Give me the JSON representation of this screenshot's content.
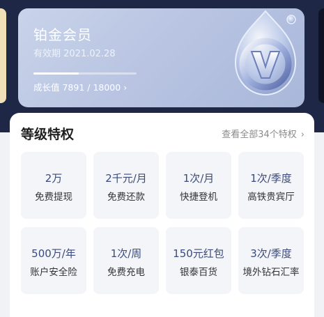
{
  "member": {
    "tier_name": "铂金会员",
    "validity": "有效期 2021.02.28",
    "growth_label": "成长值 7891 / 18000",
    "growth_chevron": "›",
    "progress_fraction": 0.44
  },
  "privileges": {
    "title": "等级特权",
    "view_all": "查看全部34个特权",
    "view_all_chevron": "›",
    "items": [
      {
        "value": "2万",
        "label": "免费提现"
      },
      {
        "value": "2千元/月",
        "label": "免费还款"
      },
      {
        "value": "1次/月",
        "label": "快捷登机"
      },
      {
        "value": "1次/季度",
        "label": "高铁贵宾厅"
      },
      {
        "value": "500万/年",
        "label": "账户安全险"
      },
      {
        "value": "1次/周",
        "label": "免费充电"
      },
      {
        "value": "150元红包",
        "label": "银泰百货"
      },
      {
        "value": "3次/季度",
        "label": "境外钻石汇率"
      }
    ]
  },
  "icons": {
    "badge": "v-badge-icon",
    "chevron": "chevron-right-icon"
  },
  "colors": {
    "page_bg": "#1f2747",
    "card": "#b9c5e2",
    "tile_value": "#3b4a7a"
  }
}
